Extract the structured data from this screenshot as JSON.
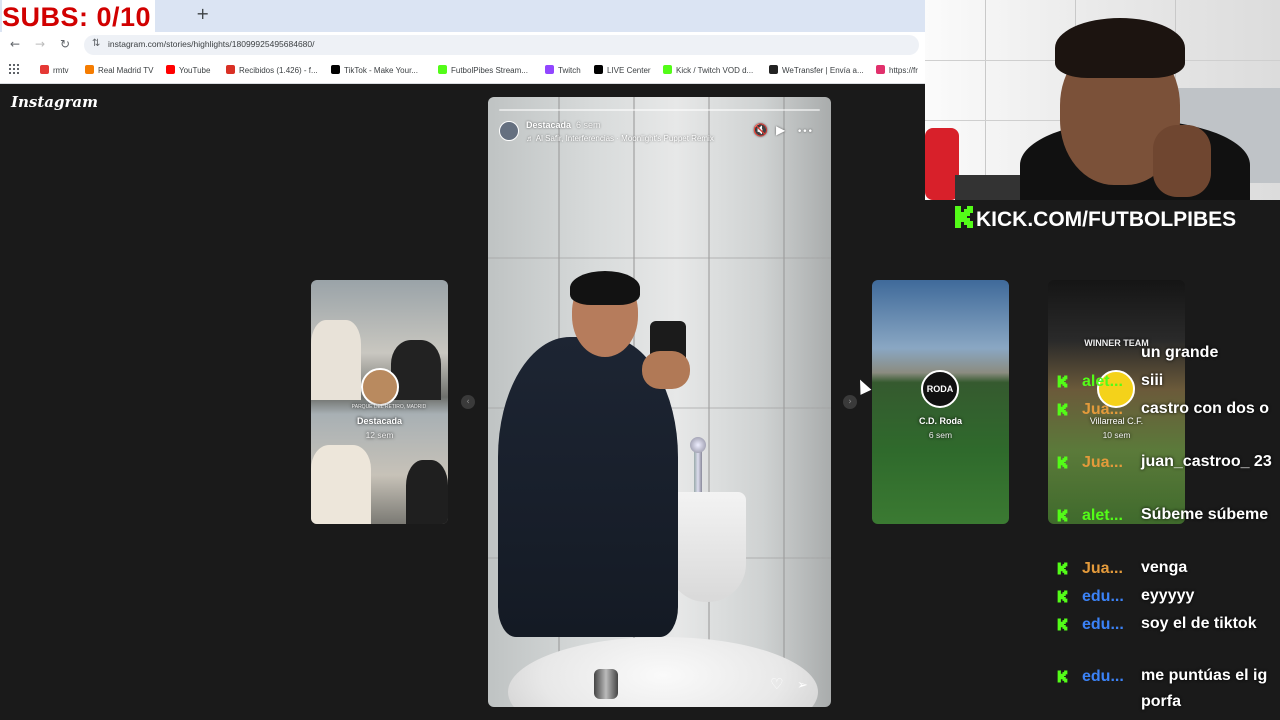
{
  "overlay": {
    "subs_label": "SUBS: 0/10"
  },
  "browser": {
    "new_tab": "+",
    "back_icon": "←",
    "forward_icon": "→",
    "reload_icon": "↻",
    "site_info_icon": "⇅",
    "url": "instagram.com/stories/highlights/18099925495684680/",
    "bookmarks": [
      {
        "label": "rmtv",
        "color": "#e53935"
      },
      {
        "label": "Real Madrid TV",
        "color": "#f57c00"
      },
      {
        "label": "YouTube",
        "color": "#ff0000"
      },
      {
        "label": "Recibidos (1.426) - f...",
        "color": "#d93025"
      },
      {
        "label": "TikTok - Make Your...",
        "color": "#000000"
      },
      {
        "label": "FutbolPibes Stream...",
        "color": "#53fc18"
      },
      {
        "label": "Twitch",
        "color": "#9146ff"
      },
      {
        "label": "LIVE Center",
        "color": "#000000"
      },
      {
        "label": "Kick / Twitch VOD d...",
        "color": "#53fc18"
      },
      {
        "label": "WeTransfer | Envía a...",
        "color": "#222222"
      },
      {
        "label": "https://fr",
        "color": "#e1306c"
      }
    ]
  },
  "instagram": {
    "logo": "Instagram",
    "left_highlight": {
      "title": "Destacada",
      "time": "12 sem",
      "caption": "PARQUE DEL RETIRO, MADRID"
    },
    "story": {
      "username": "Destacada",
      "time": "6 sem",
      "music": "♬ Al Safir, Interferencias · Moonlight's Puppet Remix",
      "mute_icon": "🔇",
      "play_icon": "▶",
      "more_icon": "•••",
      "like_icon": "♡",
      "share_icon": "➢"
    },
    "prev_arrow": "‹",
    "next_arrow": "›",
    "right_highlight_1": {
      "title": "C.D. Roda",
      "time": "6 sem",
      "badge": "RODA"
    },
    "right_highlight_2": {
      "title": "Villarreal C.F.",
      "time": "10 sem",
      "banner": "WINNER TEAM"
    }
  },
  "stream": {
    "kick_url": "KICK.COM/FUTBOLPIBES",
    "chat": [
      {
        "user": "",
        "color": "#ffffff",
        "text": "un grande"
      },
      {
        "user": "alet...",
        "color": "#53fc18",
        "text": "siii"
      },
      {
        "user": "Jua...",
        "color": "#e39a3b",
        "text": "castro con dos o"
      },
      {
        "user": "Jua...",
        "color": "#e39a3b",
        "text": "juan_castroo_ 23"
      },
      {
        "user": "alet...",
        "color": "#53fc18",
        "text": "Súbeme súbeme"
      },
      {
        "user": "Jua...",
        "color": "#e39a3b",
        "text": "venga"
      },
      {
        "user": "edu...",
        "color": "#3b82f6",
        "text": "eyyyyy"
      },
      {
        "user": "edu...",
        "color": "#3b82f6",
        "text": "soy el de tiktok"
      },
      {
        "user": "edu...",
        "color": "#3b82f6",
        "text": "me puntúas el ig porfa"
      }
    ]
  },
  "colors": {
    "kick_green": "#53fc18",
    "subs_red": "#d10000",
    "ig_bg": "#1a1a1a"
  }
}
